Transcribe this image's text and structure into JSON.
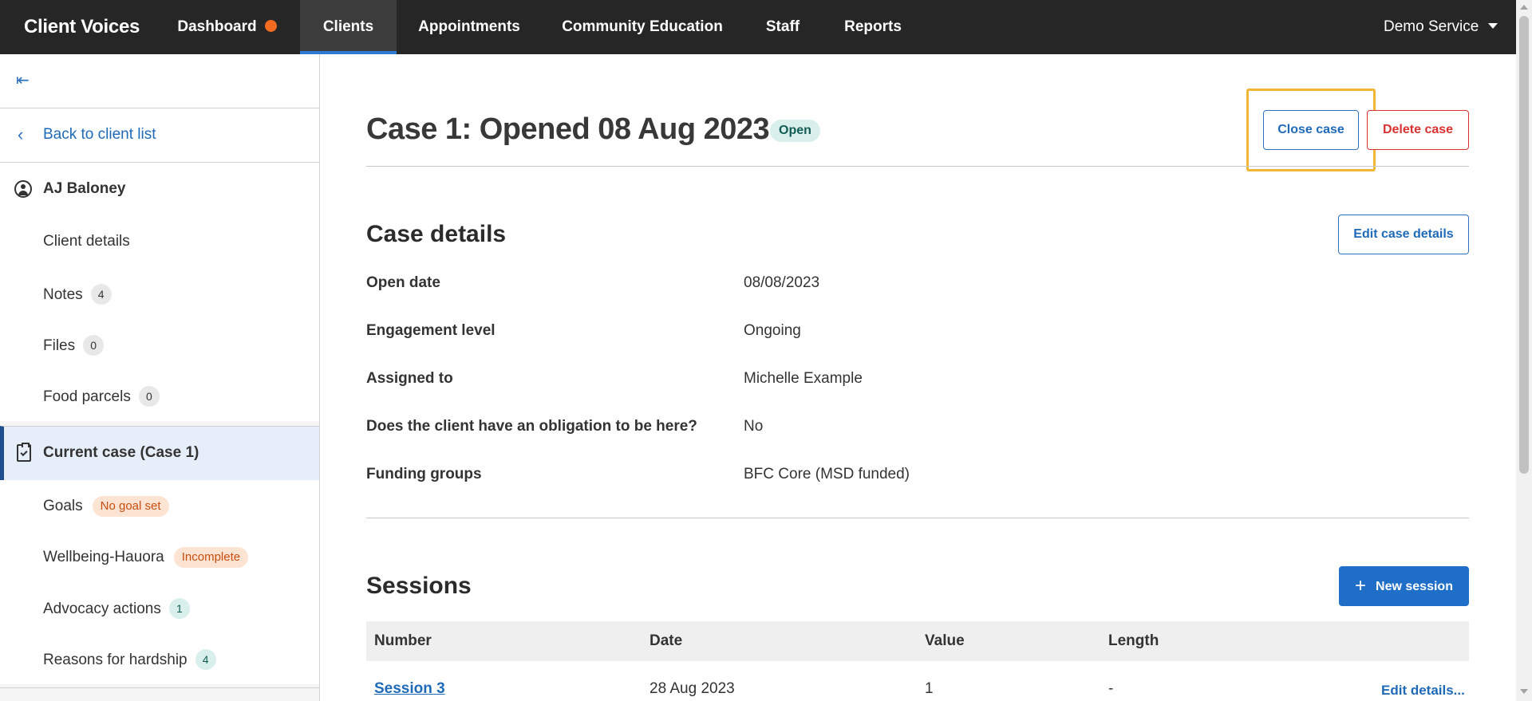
{
  "topnav": {
    "brand": "Client Voices",
    "items": [
      {
        "label": "Dashboard"
      },
      {
        "label": "Clients"
      },
      {
        "label": "Appointments"
      },
      {
        "label": "Community Education"
      },
      {
        "label": "Staff"
      },
      {
        "label": "Reports"
      }
    ],
    "service": "Demo Service"
  },
  "sidebar": {
    "collapse_icon": "collapse-sidebar-icon",
    "back_label": "Back to client list",
    "client_name": "AJ Baloney",
    "items": [
      {
        "label": "Client details"
      },
      {
        "label": "Notes",
        "count": "4"
      },
      {
        "label": "Files",
        "count": "0"
      },
      {
        "label": "Food parcels",
        "count": "0"
      }
    ],
    "current_case": "Current case (Case 1)",
    "case_items": [
      {
        "label": "Goals",
        "badge": "No goal set"
      },
      {
        "label": "Wellbeing-Hauora",
        "badge": "Incomplete"
      },
      {
        "label": "Advocacy actions",
        "count": "1"
      },
      {
        "label": "Reasons for hardship",
        "count": "4"
      }
    ]
  },
  "case": {
    "title": "Case 1: Opened 08 Aug 2023",
    "status": "Open",
    "close_label": "Close case",
    "delete_label": "Delete case"
  },
  "details": {
    "heading": "Case details",
    "edit_label": "Edit case details",
    "rows": [
      {
        "label": "Open date",
        "value": "08/08/2023"
      },
      {
        "label": "Engagement level",
        "value": "Ongoing"
      },
      {
        "label": "Assigned to",
        "value": "Michelle Example"
      },
      {
        "label": "Does the client have an obligation to be here?",
        "value": "No"
      },
      {
        "label": "Funding groups",
        "value": "BFC Core (MSD funded)"
      }
    ]
  },
  "sessions": {
    "heading": "Sessions",
    "new_label": "New session",
    "columns": [
      "Number",
      "Date",
      "Value",
      "Length"
    ],
    "rows": [
      {
        "number": "Session 3",
        "date": "28 Aug 2023",
        "value": "1",
        "length": "-",
        "action": "Edit details..."
      }
    ]
  },
  "colors": {
    "nav_bg": "#262626",
    "accent": "#1f6fc9",
    "danger": "#d83232",
    "focus_ring": "#f2b636",
    "notification_dot": "#f26b21"
  }
}
